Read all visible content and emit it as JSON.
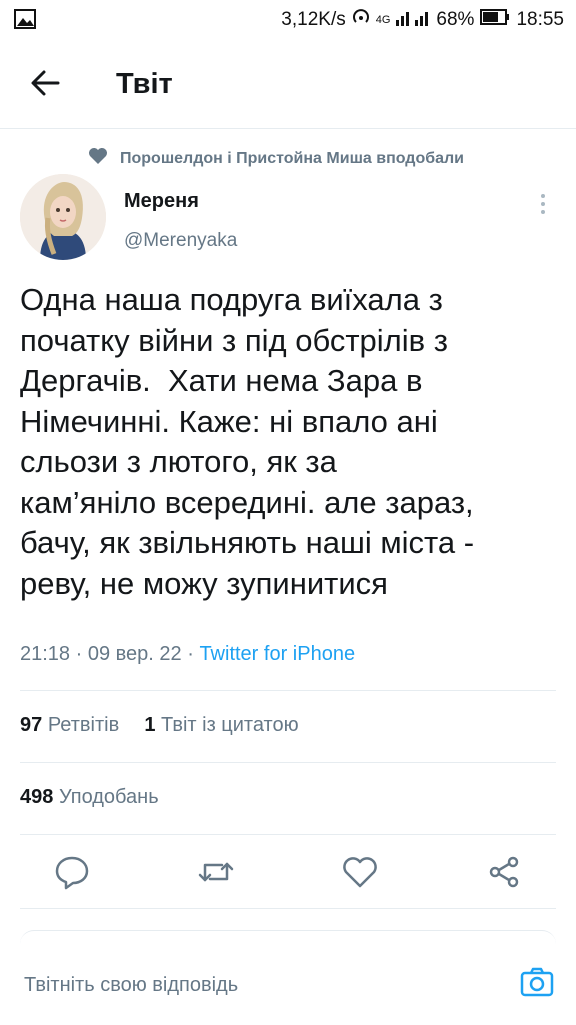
{
  "status_bar": {
    "speed": "3,12K/s",
    "network": "4G",
    "battery": "68%",
    "time": "18:55"
  },
  "header": {
    "title": "Твіт"
  },
  "social_context": "Порошелдон і Пристойна Миша вподобали",
  "author": {
    "name": "Мереня",
    "handle": "@Merenyaka"
  },
  "tweet": {
    "text": "Одна наша подруга виїхала з\nпочатку війни з під обстрілів з\nДергачів.  Хати нема Зара в\nНімечинні. Каже: ні впало ані\nсльози з лютого, як за\nкам’яніло всередині. але зараз,\nбачу, як звільняють наші міста -\nреву, не можу зупинитися",
    "time": "21:18",
    "date": "09 вер. 22",
    "source": "Twitter for iPhone"
  },
  "stats": {
    "retweets_count": "97",
    "retweets_label": "Ретвітів",
    "quotes_count": "1",
    "quotes_label": "Твіт із цитатою",
    "likes_count": "498",
    "likes_label": "Уподобань"
  },
  "reply": {
    "placeholder": "Твітніть свою відповідь"
  },
  "colors": {
    "accent": "#1da1f2",
    "secondary_text": "#657786",
    "primary_text": "#14171a",
    "divider": "#e6ecf0"
  },
  "icons": [
    "gallery-icon",
    "hotspot-icon",
    "signal-icon",
    "battery-icon",
    "back-arrow-icon",
    "heart-icon",
    "more-icon",
    "reply-icon",
    "retweet-icon",
    "like-icon",
    "share-icon",
    "camera-icon"
  ]
}
